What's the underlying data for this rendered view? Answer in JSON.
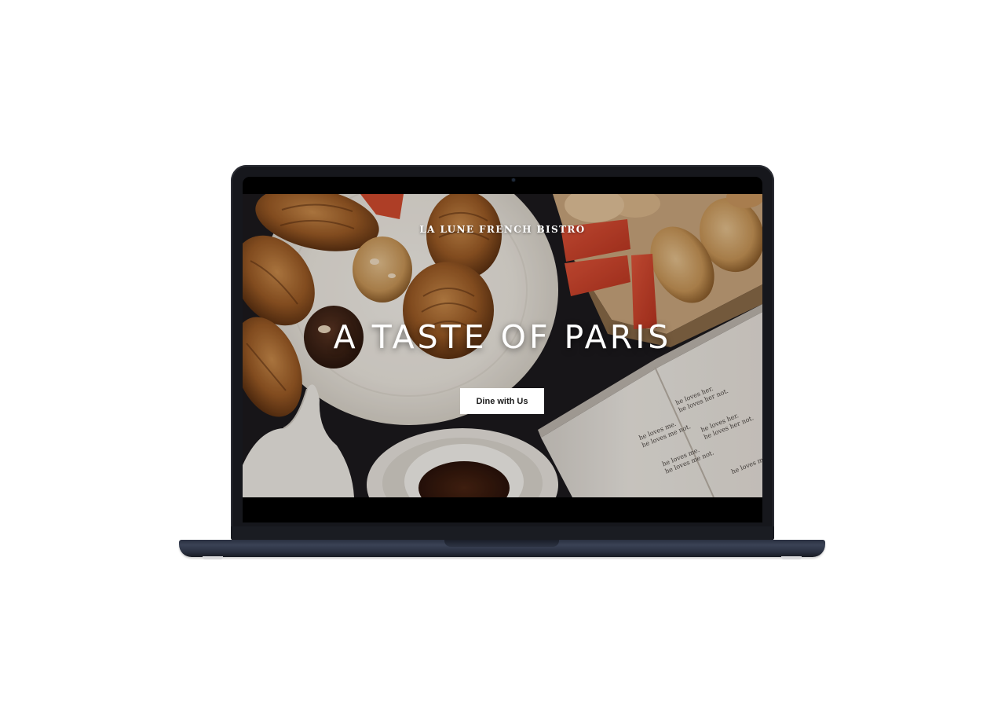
{
  "site": {
    "brand": "LA LUNE FRENCH BISTRO",
    "headline": "A TASTE OF PARIS",
    "cta_label": "Dine with Us"
  },
  "book_lines": [
    "he loves me.",
    "he loves me not.",
    "he loves her.",
    "he loves her not.",
    "he loves me.",
    "he loves me not.",
    "he loves her.",
    "he loves her not.",
    "he loves me not."
  ],
  "colors": {
    "laptop_body": "#16171c",
    "laptop_base": "#2f3546",
    "cta_background": "#ffffff",
    "cta_text": "#1a1a1a",
    "headline_text": "#ffffff"
  },
  "icons": {
    "camera": "camera-icon"
  }
}
